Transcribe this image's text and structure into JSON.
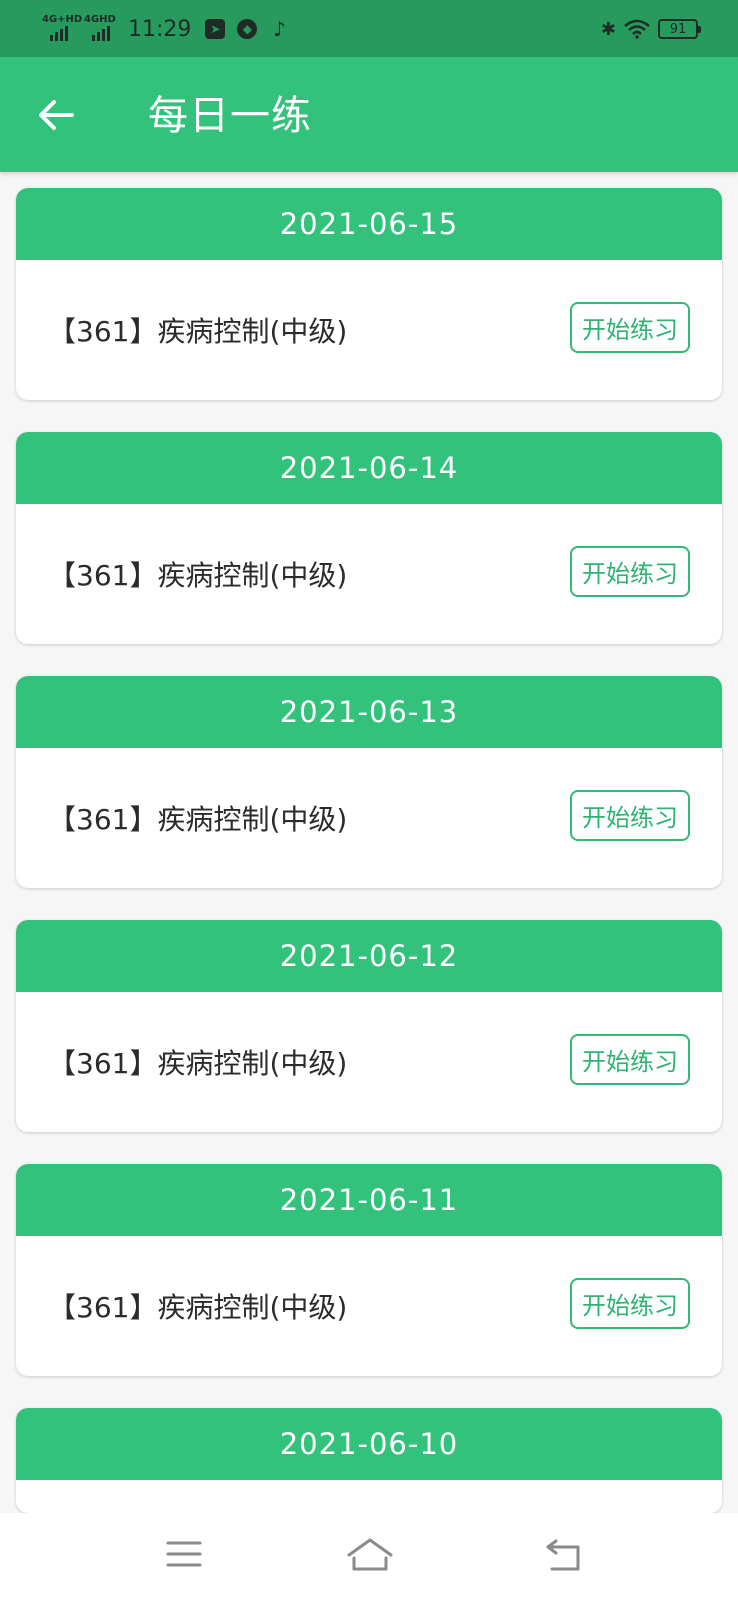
{
  "status_bar": {
    "signal1_label": "4G+HD",
    "signal2_label": "4GHD",
    "time": "11:29",
    "battery": "91",
    "icons": [
      "telegram-icon",
      "compass-icon",
      "tiktok-icon",
      "bluetooth-icon",
      "wifi-icon",
      "battery-icon"
    ]
  },
  "header": {
    "title": "每日一练",
    "back_icon": "arrow-left-icon"
  },
  "colors": {
    "primary": "#33c27c",
    "status_bar": "#279a5e",
    "background": "#f6f6f6",
    "button_border": "#33b877"
  },
  "practices": [
    {
      "date": "2021-06-15",
      "title": "【361】疾病控制(中级)",
      "button": "开始练习"
    },
    {
      "date": "2021-06-14",
      "title": "【361】疾病控制(中级)",
      "button": "开始练习"
    },
    {
      "date": "2021-06-13",
      "title": "【361】疾病控制(中级)",
      "button": "开始练习"
    },
    {
      "date": "2021-06-12",
      "title": "【361】疾病控制(中级)",
      "button": "开始练习"
    },
    {
      "date": "2021-06-11",
      "title": "【361】疾病控制(中级)",
      "button": "开始练习"
    },
    {
      "date": "2021-06-10"
    }
  ],
  "nav_bar": {
    "icons": [
      "menu-icon",
      "home-icon",
      "back-icon"
    ]
  }
}
